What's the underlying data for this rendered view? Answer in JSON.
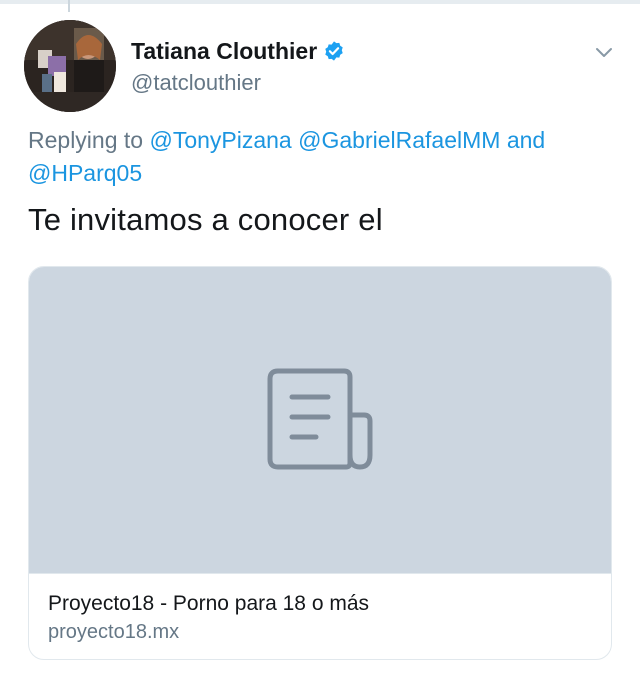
{
  "tweet": {
    "author": {
      "display_name": "Tatiana Clouthier",
      "handle": "@tatclouthier",
      "verified": true,
      "avatar_icon": "profile-photo"
    },
    "reply": {
      "prefix": "Replying to",
      "mentions": [
        "@TonyPizana",
        "@GabrielRafaelMM",
        "@HParq05"
      ],
      "conjunction": "and"
    },
    "text": "Te invitamos a conocer el",
    "card": {
      "placeholder_icon": "document-icon",
      "title": "Proyecto18 - Porno para 18 o más",
      "domain": "proyecto18.mx"
    },
    "menu_icon": "chevron-down-icon"
  },
  "colors": {
    "text_primary": "#14171a",
    "text_secondary": "#657786",
    "link": "#1b95e0",
    "verified": "#1da1f2",
    "card_placeholder": "#ccd6e0",
    "icon_stroke": "#7f8c9a",
    "border": "#e1e8ed"
  }
}
